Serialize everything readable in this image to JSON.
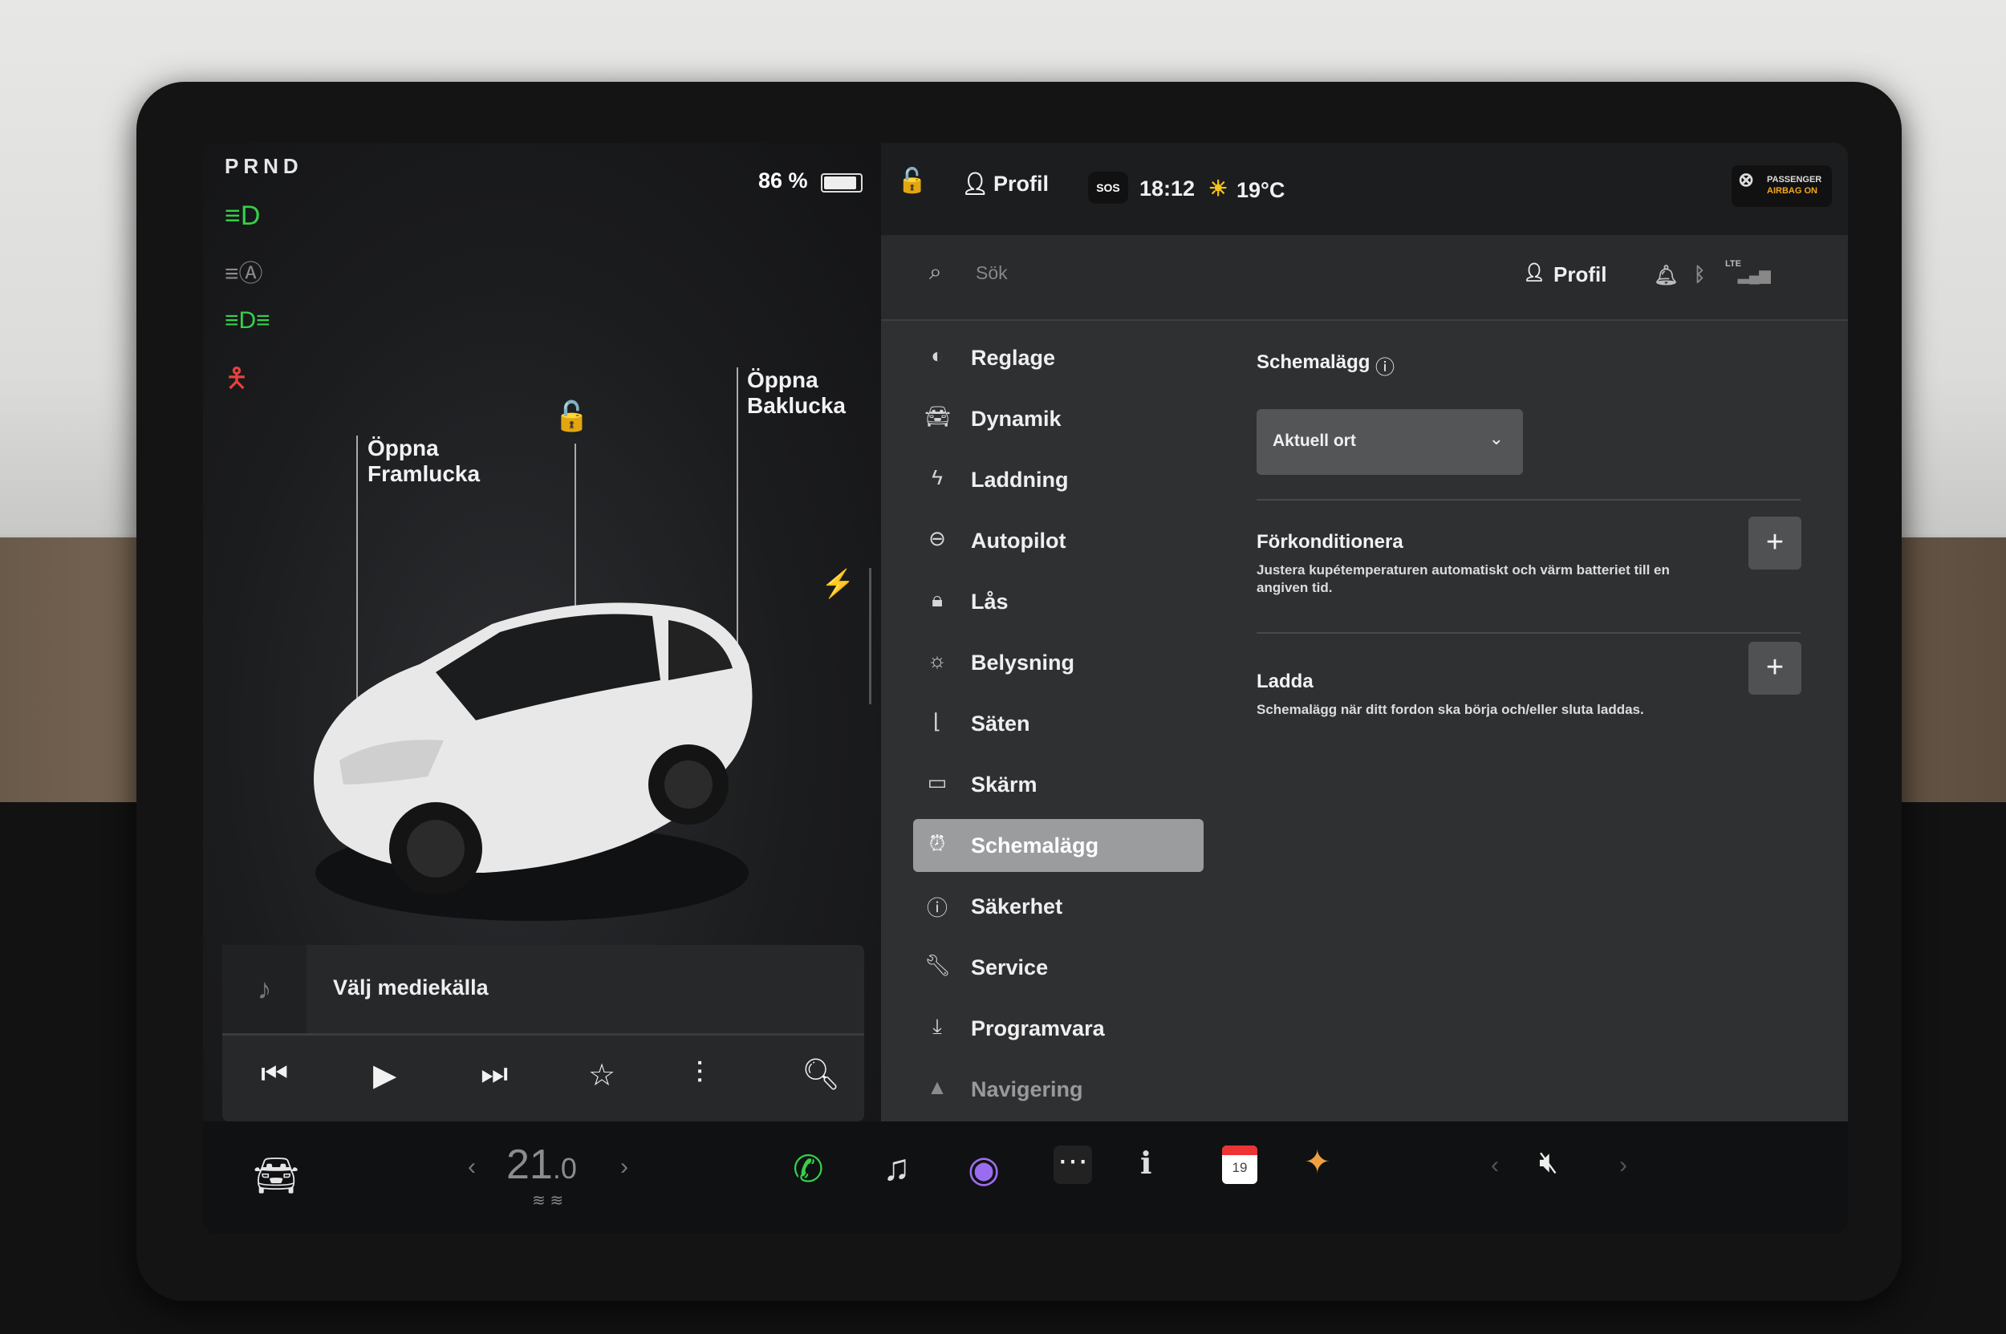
{
  "gear": "PRND",
  "battery": {
    "percent_label": "86 %",
    "level": 0.86
  },
  "car_panel": {
    "frunk_label": "Öppna\nFramlucka",
    "trunk_label": "Öppna\nBaklucka"
  },
  "media": {
    "source_label": "Välj mediekälla"
  },
  "status_bar": {
    "profile": "Profil",
    "sos": "SOS",
    "time": "18:12",
    "temperature": "19°C",
    "airbag_line1": "PASSENGER",
    "airbag_line2": "AIRBAG ON"
  },
  "search": {
    "placeholder": "Sök",
    "profile": "Profil",
    "lte": "LTE"
  },
  "menu": {
    "items": [
      {
        "label": "Reglage",
        "icon": "toggle-icon"
      },
      {
        "label": "Dynamik",
        "icon": "car-icon"
      },
      {
        "label": "Laddning",
        "icon": "bolt-icon"
      },
      {
        "label": "Autopilot",
        "icon": "steering-wheel-icon"
      },
      {
        "label": "Lås",
        "icon": "lock-icon"
      },
      {
        "label": "Belysning",
        "icon": "sun-icon"
      },
      {
        "label": "Säten",
        "icon": "seat-icon"
      },
      {
        "label": "Skärm",
        "icon": "display-icon"
      },
      {
        "label": "Schemalägg",
        "icon": "alarm-clock-icon",
        "active": true
      },
      {
        "label": "Säkerhet",
        "icon": "alert-circle-icon"
      },
      {
        "label": "Service",
        "icon": "wrench-icon"
      },
      {
        "label": "Programvara",
        "icon": "download-icon"
      },
      {
        "label": "Navigering",
        "icon": "navigation-icon"
      }
    ]
  },
  "schedule": {
    "title": "Schemalägg",
    "location_value": "Aktuell ort",
    "precondition_title": "Förkonditionera",
    "precondition_desc": "Justera kupétemperaturen automatiskt och värm batteriet till en angiven tid.",
    "charge_title": "Ladda",
    "charge_desc": "Schemalägg när ditt fordon ska börja och/eller sluta laddas."
  },
  "taskbar": {
    "cabin_temp_main": "21",
    "cabin_temp_decimal": ".0",
    "calendar_day": "19"
  },
  "colors": {
    "accent_green": "#35d04a",
    "warning_red": "#e8413c",
    "active_menu": "#9b9c9e"
  }
}
